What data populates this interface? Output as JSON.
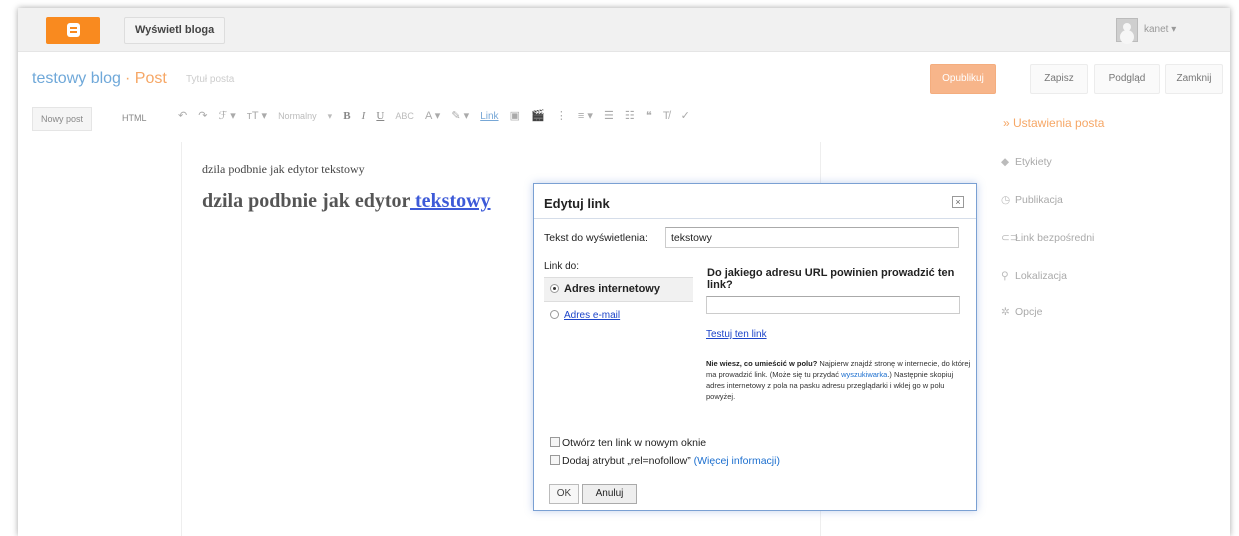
{
  "topbar": {
    "view_blog": "Wyświetl bloga",
    "user": "kanet ▾"
  },
  "header": {
    "blog_title": "testowy blog",
    "separator_title": "· Post",
    "post_title_placeholder": "Tytuł posta",
    "publish": "Opublikuj",
    "save": "Zapisz",
    "preview": "Podgląd",
    "close": "Zamknij"
  },
  "toolbar": {
    "new_post": "Nowy post",
    "html": "HTML",
    "undo": "↶",
    "redo": "↷",
    "font": "ℱ ▾",
    "font_size": "тT ▾",
    "format": "Normalny",
    "format_caret": "▾",
    "bold": "B",
    "italic": "I",
    "underline": "U",
    "strike": "ABC",
    "text_color": "A ▾",
    "highlight": "✎ ▾",
    "link": "Link",
    "image": "▣",
    "video": "🎬",
    "page_break": "⋮",
    "align": "≡ ▾",
    "ordered_list": "☰",
    "bullet_list": "☷",
    "quote": "❝",
    "clear": "T̸",
    "spell": "✓"
  },
  "editor": {
    "line1": "dzila podbnie jak edytor tekstowy",
    "line2_plain": "dzila podbnie jak edytor",
    "line2_link": " tekstowy"
  },
  "sidebar": {
    "title": "» Ustawienia posta",
    "items": [
      {
        "icon": "◆",
        "label": "Etykiety"
      },
      {
        "icon": "◷",
        "label": "Publikacja"
      },
      {
        "icon": "⊂⊃",
        "label": "Link bezpośredni"
      },
      {
        "icon": "⚲",
        "label": "Lokalizacja"
      },
      {
        "icon": "✲",
        "label": "Opcje"
      }
    ]
  },
  "dialog": {
    "title": "Edytuj link",
    "close": "×",
    "text_label": "Tekst do wyświetlenia:",
    "text_value": "tekstowy",
    "link_to_label": "Link do:",
    "option_url": "Adres internetowy",
    "option_email": "Adres e-mail",
    "question": "Do jakiego adresu URL powinien prowadzić ten link?",
    "url_value": "",
    "test_link": "Testuj ten link",
    "help_bold": "Nie wiesz, co umieścić w polu?",
    "help_1": " Najpierw znajdź stronę w internecie, do której ma prowadzić link. (Może się tu przydać ",
    "help_link": "wyszukiwarka",
    "help_2": ".) Następnie skopiuj adres internetowy z pola na pasku adresu przeglądarki i wklej go w polu powyżej.",
    "new_window": "Otwórz ten link w nowym oknie",
    "nofollow": "Dodaj atrybut „rel=nofollow”",
    "more_info": "(Więcej informacji)",
    "ok": "OK",
    "cancel": "Anuluj"
  }
}
